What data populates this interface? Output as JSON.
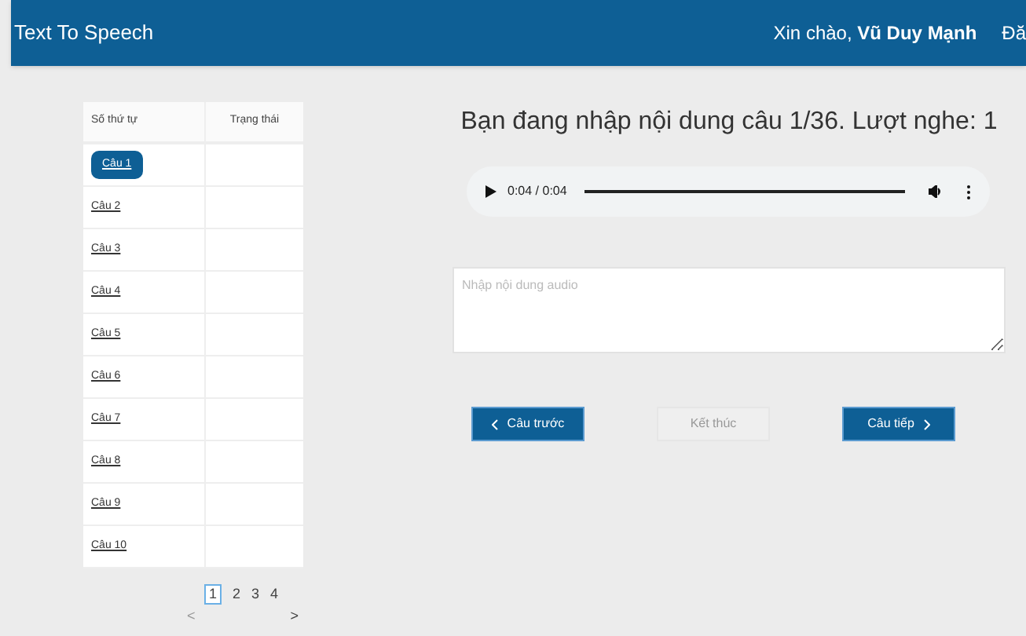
{
  "header": {
    "title": "Text To Speech",
    "greeting": "Xin chào, **Vũ Duy Mạnh**",
    "cut_link": "Đă"
  },
  "table": {
    "columns": [
      "Số thứ tự",
      "Trạng thái"
    ],
    "rows": [
      {
        "label": "Câu 1",
        "selected": true
      },
      {
        "label": "Câu 2",
        "selected": false
      },
      {
        "label": "Câu 3",
        "selected": false
      },
      {
        "label": "Câu 4",
        "selected": false
      },
      {
        "label": "Câu 5",
        "selected": false
      },
      {
        "label": "Câu 6",
        "selected": false
      },
      {
        "label": "Câu 7",
        "selected": false
      },
      {
        "label": "Câu 8",
        "selected": false
      },
      {
        "label": "Câu 9",
        "selected": false
      },
      {
        "label": "Câu 10",
        "selected": false
      }
    ]
  },
  "pagination": {
    "pages": [
      {
        "label": "1",
        "selected": true
      },
      {
        "label": "2",
        "selected": false
      },
      {
        "label": "3",
        "selected": false
      },
      {
        "label": "4",
        "selected": false
      }
    ],
    "prev": {
      "label": "<",
      "disabled": true
    },
    "next": {
      "label": ">",
      "disabled": false
    }
  },
  "heading": "Bạn đang nhập nội dung câu 1/36. Lượt nghe: 1",
  "audio": {
    "time": "0:04 / 0:04",
    "level": 1
  },
  "answer": {
    "placeholder": "Nhập nội dung audio"
  },
  "buttons": [
    {
      "kind": "prev",
      "label": "Câu trước",
      "disabled": false
    },
    {
      "kind": "finish",
      "label": "Kết thúc",
      "disabled": true
    },
    {
      "kind": "next",
      "label": "Câu tiếp",
      "disabled": false
    }
  ]
}
